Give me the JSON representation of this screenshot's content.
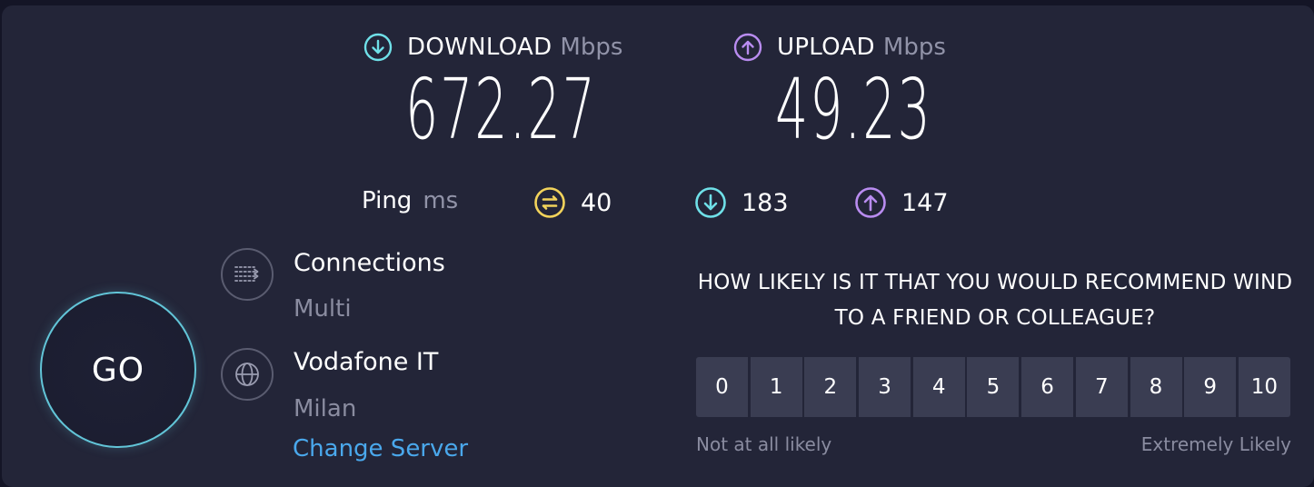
{
  "download": {
    "label": "DOWNLOAD",
    "unit": "Mbps",
    "value": "672.27"
  },
  "upload": {
    "label": "UPLOAD",
    "unit": "Mbps",
    "value": "49.23"
  },
  "ping": {
    "label": "Ping",
    "unit": "ms",
    "idle": "40",
    "down": "183",
    "up": "147"
  },
  "go_label": "GO",
  "connections": {
    "title": "Connections",
    "value": "Multi"
  },
  "server": {
    "provider": "Vodafone IT",
    "location": "Milan",
    "change_label": "Change Server"
  },
  "survey": {
    "question": "HOW LIKELY IS IT THAT YOU WOULD RECOMMEND WIND TO A FRIEND OR COLLEAGUE?",
    "scale": [
      "0",
      "1",
      "2",
      "3",
      "4",
      "5",
      "6",
      "7",
      "8",
      "9",
      "10"
    ],
    "low_label": "Not at all likely",
    "high_label": "Extremely Likely"
  },
  "colors": {
    "background": "#141526",
    "panel": "#232538",
    "download_accent": "#6fe0e8",
    "upload_accent": "#b98cf0",
    "ping_accent": "#f2d35b",
    "go_ring": "#62c5d8",
    "link": "#4aa8ec"
  },
  "icons": {
    "download": "arrow-down-circle-icon",
    "upload": "arrow-up-circle-icon",
    "ping": "jitter-circle-icon",
    "connections": "multi-connections-icon",
    "server": "globe-icon"
  }
}
